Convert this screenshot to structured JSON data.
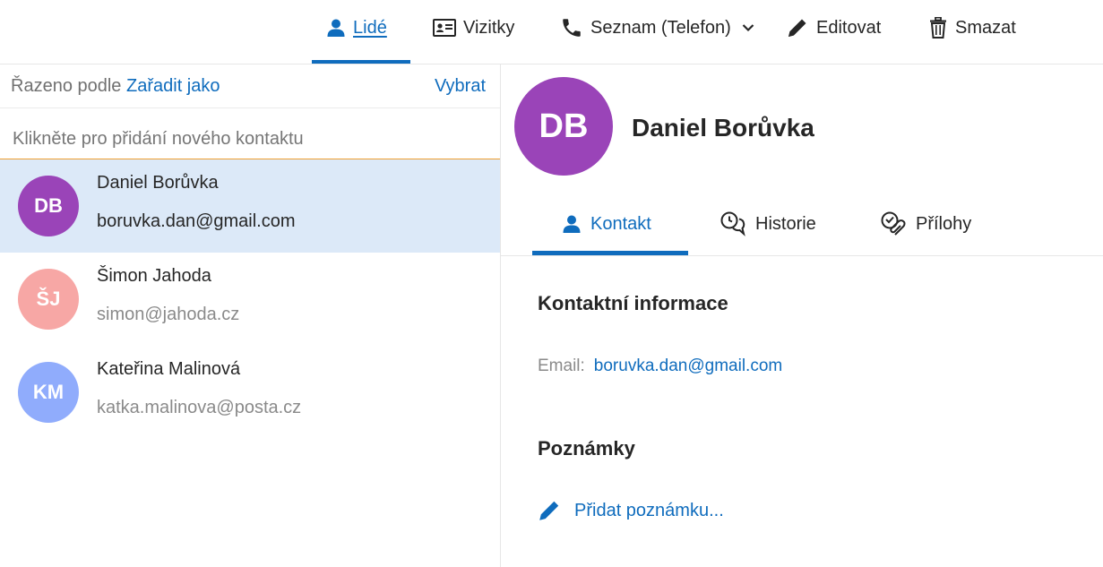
{
  "toolbar": {
    "items": [
      {
        "label": "Lidé",
        "icon": "person-icon",
        "active": true
      },
      {
        "label": "Vizitky",
        "icon": "id-card-icon"
      },
      {
        "label": "Seznam (Telefon)",
        "icon": "phone-icon",
        "dropdown": true
      },
      {
        "label": "Editovat",
        "icon": "pencil-icon"
      },
      {
        "label": "Smazat",
        "icon": "trash-icon"
      }
    ]
  },
  "list": {
    "sort_prefix": "Řazeno podle",
    "sort_value": "Zařadit jako",
    "select_label": "Vybrat",
    "add_placeholder": "Klikněte pro přidání nového kontaktu",
    "contacts": [
      {
        "initials": "DB",
        "name": "Daniel Borůvka",
        "email": "boruvka.dan@gmail.com",
        "color": "#9a44b8",
        "selected": true
      },
      {
        "initials": "ŠJ",
        "name": "Šimon Jahoda",
        "email": "simon@jahoda.cz",
        "color": "#f7a7a5",
        "selected": false
      },
      {
        "initials": "KM",
        "name": "Kateřina Malinová",
        "email": "katka.malinova@posta.cz",
        "color": "#90acfc",
        "selected": false
      }
    ]
  },
  "detail": {
    "initials": "DB",
    "name": "Daniel Borůvka",
    "avatar_color": "#9a44b8",
    "tabs": [
      {
        "label": "Kontakt",
        "icon": "person-icon",
        "active": true
      },
      {
        "label": "Historie",
        "icon": "chat-history-icon"
      },
      {
        "label": "Přílohy",
        "icon": "attachment-icon"
      }
    ],
    "contact_info_title": "Kontaktní informace",
    "email_label": "Email:",
    "email_value": "boruvka.dan@gmail.com",
    "notes_title": "Poznámky",
    "add_note_label": "Přidat poznámku..."
  },
  "colors": {
    "accent": "#0f6cbd",
    "selected_row": "#dce9f8",
    "add_underline": "#f0a030"
  }
}
